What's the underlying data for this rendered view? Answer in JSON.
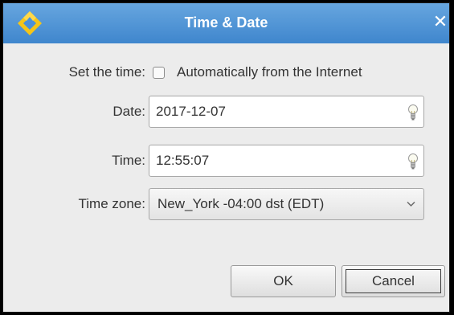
{
  "window": {
    "title": "Time & Date",
    "close_glyph": "✕",
    "app_icon": "yellow-diamond-icon"
  },
  "form": {
    "set_time_label": "Set the time:",
    "auto_checkbox_label": "Automatically from the Internet",
    "auto_checked": false,
    "date_label": "Date:",
    "date_value": "2017-12-07",
    "time_label": "Time:",
    "time_value": "12:55:07",
    "timezone_label": "Time zone:",
    "timezone_value": "New_York -04:00 dst (EDT)",
    "field_icon": "lightbulb-icon"
  },
  "buttons": {
    "ok": "OK",
    "cancel": "Cancel"
  },
  "colors": {
    "titlebar": "#4a90d9",
    "icon_yellow": "#f5c518"
  }
}
